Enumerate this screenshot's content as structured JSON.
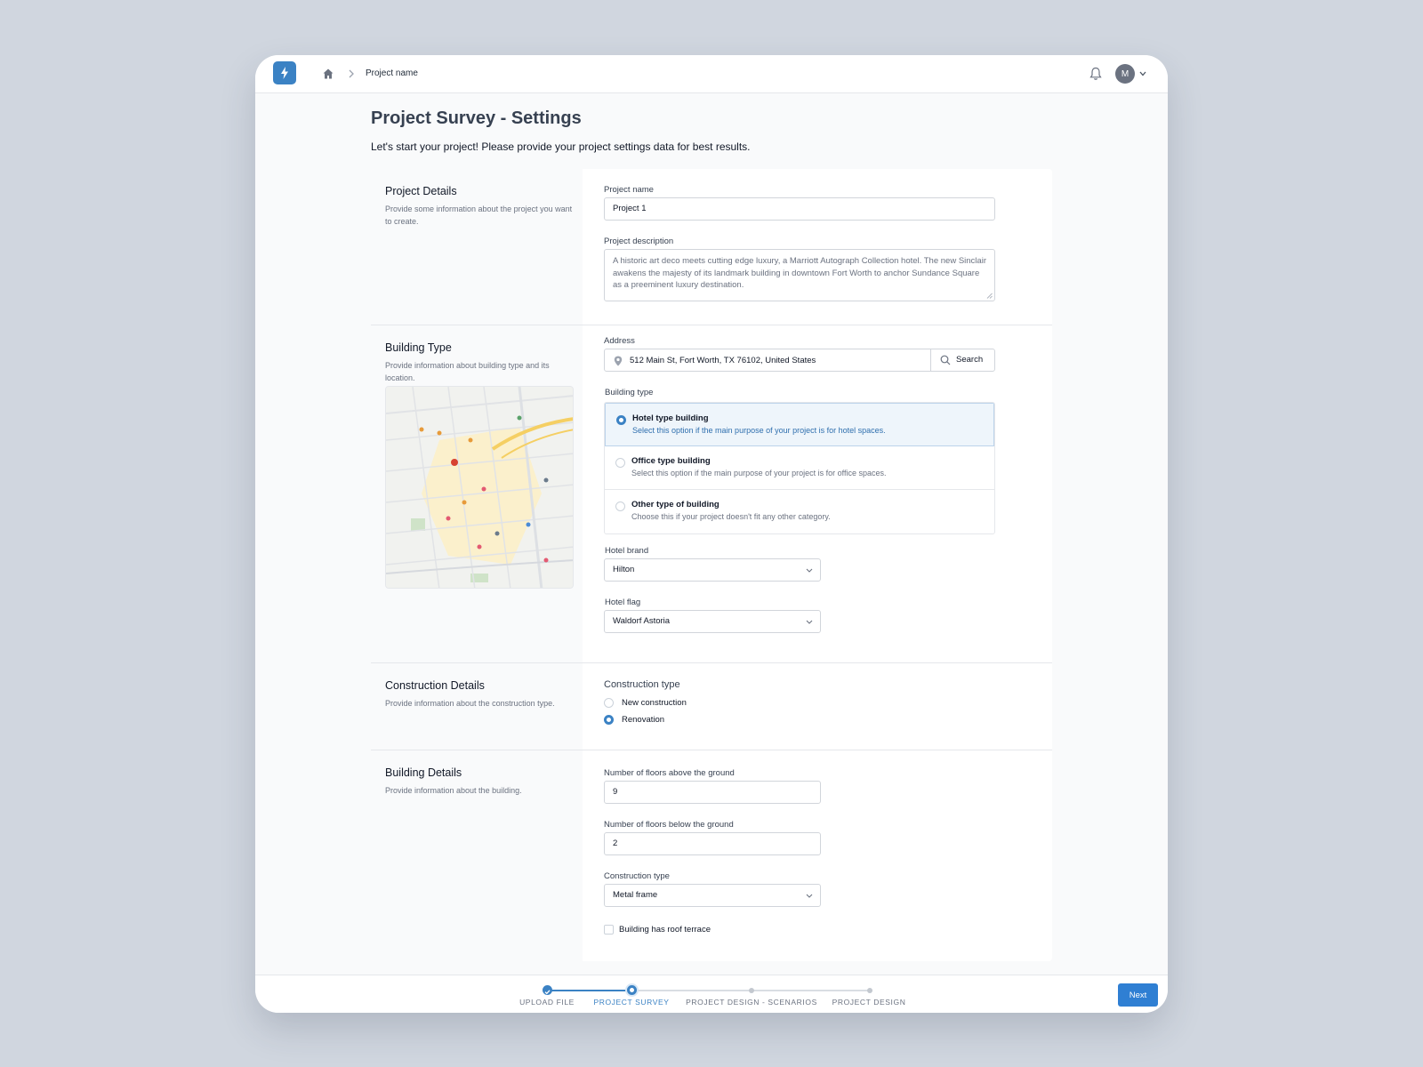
{
  "app": {
    "breadcrumb": {
      "current": "Project name"
    },
    "user": {
      "avatar_initial": "M"
    },
    "colors": {
      "accent": "#3b82c4",
      "next_button": "#2f7fd3"
    }
  },
  "page": {
    "title": "Project Survey - Settings",
    "subtitle": "Let's start your project! Please provide your project settings data for best results."
  },
  "sections": {
    "project_details": {
      "title": "Project Details",
      "description": "Provide some information about the project you want to create.",
      "name_label": "Project name",
      "name_value": "Project 1",
      "desc_label": "Project description",
      "desc_value": "A historic art deco meets cutting edge luxury, a Marriott Autograph Collection hotel. The new Sinclair awakens the majesty of its landmark building in downtown Fort Worth to anchor Sundance Square as a preeminent luxury destination."
    },
    "building_type": {
      "title": "Building Type",
      "description": "Provide information about building type and its location.",
      "address_label": "Address",
      "address_value": "512 Main St, Fort Worth, TX 76102, United States",
      "search_label": "Search",
      "type_label": "Building type",
      "options": [
        {
          "title": "Hotel type building",
          "desc": "Select this option if the main purpose of your project is for hotel spaces.",
          "selected": true
        },
        {
          "title": "Office type building",
          "desc": "Select this option if the main purpose of your project is for office spaces.",
          "selected": false
        },
        {
          "title": "Other type of building",
          "desc": "Choose this if your project doesn't fit any other category.",
          "selected": false
        }
      ],
      "brand_label": "Hotel brand",
      "brand_value": "Hilton",
      "flag_label": "Hotel flag",
      "flag_value": "Waldorf Astoria"
    },
    "construction_details": {
      "title": "Construction Details",
      "description": "Provide information about the construction type.",
      "type_label": "Construction type",
      "options": [
        {
          "label": "New construction",
          "selected": false
        },
        {
          "label": "Renovation",
          "selected": true
        }
      ]
    },
    "building_details": {
      "title": "Building Details",
      "description": "Provide information about the building.",
      "floors_above_label": "Number of floors above the ground",
      "floors_above_value": "9",
      "floors_below_label": "Number of floors below the ground",
      "floors_below_value": "2",
      "construction_type_label": "Construction type",
      "construction_type_value": "Metal frame",
      "roof_terrace_label": "Building has roof terrace",
      "roof_terrace_checked": false
    }
  },
  "stepper": {
    "steps": [
      {
        "label": "UPLOAD FILE",
        "state": "done"
      },
      {
        "label": "PROJECT SURVEY",
        "state": "current"
      },
      {
        "label": "PROJECT DESIGN - SCENARIOS",
        "state": "todo"
      },
      {
        "label": "PROJECT DESIGN",
        "state": "todo"
      }
    ],
    "next_label": "Next"
  }
}
